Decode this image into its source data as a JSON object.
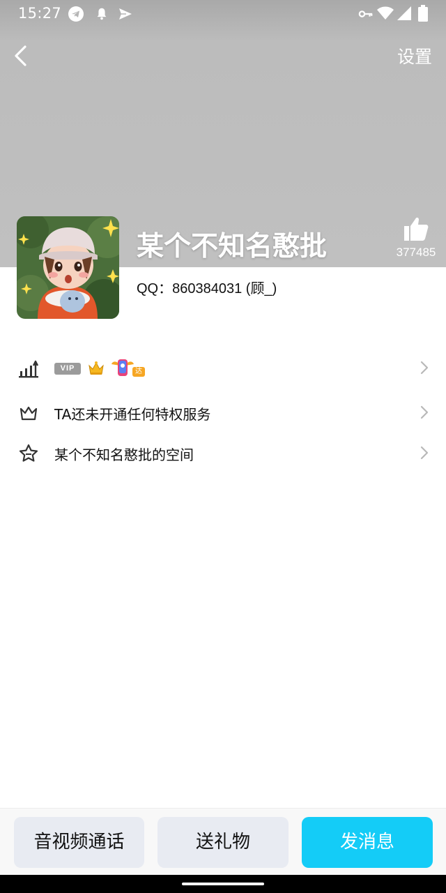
{
  "status_bar": {
    "time": "15:27",
    "icons": [
      "telegram-icon",
      "notification-bell-icon",
      "send-plane-icon",
      "vpn-key-icon",
      "wifi-icon",
      "cellular-signal-icon",
      "battery-icon"
    ]
  },
  "nav": {
    "back_icon": "chevron-left-icon",
    "settings_label": "设置"
  },
  "profile": {
    "nickname": "某个不知名憨批",
    "qq_label": "QQ：",
    "qq_number": "860384031",
    "qq_remark": " (顾_)",
    "like_icon": "thumbs-up-icon",
    "like_count": "377485"
  },
  "rows": {
    "level": {
      "icon": "level-bars-icon",
      "vip_badge": "VIP",
      "crown_icon": "crown-icon",
      "daren_badge": "达人"
    },
    "privilege": {
      "icon": "crown-outline-icon",
      "label": "TA还未开通任何特权服务"
    },
    "space": {
      "icon": "star-outline-icon",
      "label": "某个不知名憨批的空间"
    }
  },
  "bottom": {
    "call_label": "音视频通话",
    "gift_label": "送礼物",
    "message_label": "发消息"
  },
  "colors": {
    "header_bg": "#c0c0c0",
    "accent": "#14ccf7",
    "secondary_button": "#e8ebf2",
    "vip_badge": "#9b9b9b",
    "daren_badge": "#f6a623"
  }
}
